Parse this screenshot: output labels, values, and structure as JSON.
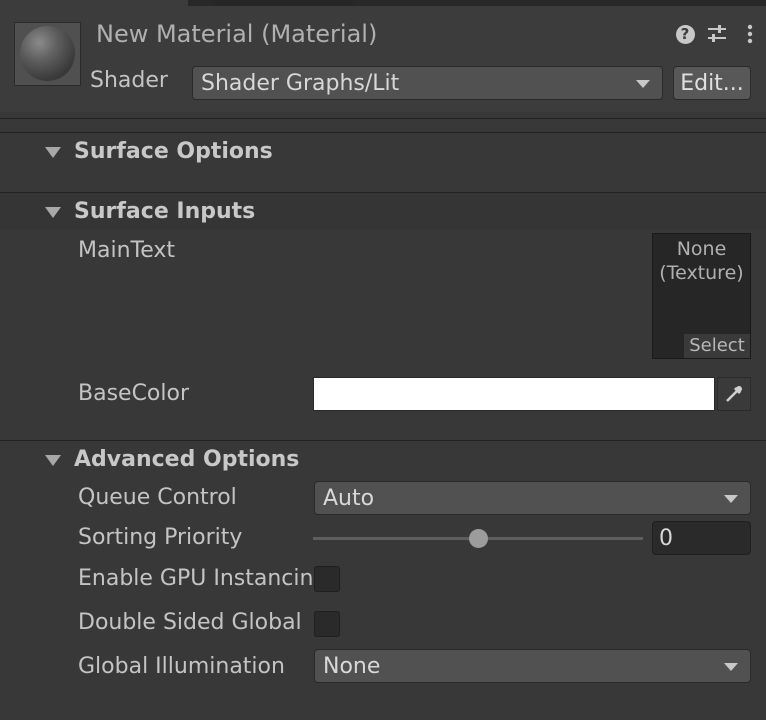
{
  "header": {
    "title": "New Material (Material)",
    "shader_label": "Shader",
    "shader_value": "Shader Graphs/Lit",
    "edit_label": "Edit..."
  },
  "icons": {
    "help": "help-icon",
    "settings": "preset-settings-icon",
    "more": "kebab-menu-icon",
    "caret": "chevron-down-icon",
    "eyedropper": "eyedropper-icon",
    "foldout": "triangle-down-icon"
  },
  "sections": {
    "surface_options": {
      "title": "Surface Options"
    },
    "surface_inputs": {
      "title": "Surface Inputs",
      "main_text_label": "MainText",
      "texture_line1": "None",
      "texture_line2": "(Texture)",
      "texture_select": "Select",
      "base_color_label": "BaseColor",
      "base_color_value": "#FFFFFF"
    },
    "advanced_options": {
      "title": "Advanced Options",
      "queue_label": "Queue Control",
      "queue_value": "Auto",
      "sorting_label": "Sorting Priority",
      "sorting_value": "0",
      "sorting_slider_fraction": 0.5,
      "gpu_label": "Enable GPU Instancing",
      "gpu_checked": false,
      "double_sided_label": "Double Sided Global Illumination",
      "double_sided_checked": false,
      "gi_label": "Global Illumination",
      "gi_value": "None"
    }
  },
  "colors": {
    "background": "#383838",
    "header_background": "#3C3C3C",
    "text": "#C4C4C4"
  }
}
